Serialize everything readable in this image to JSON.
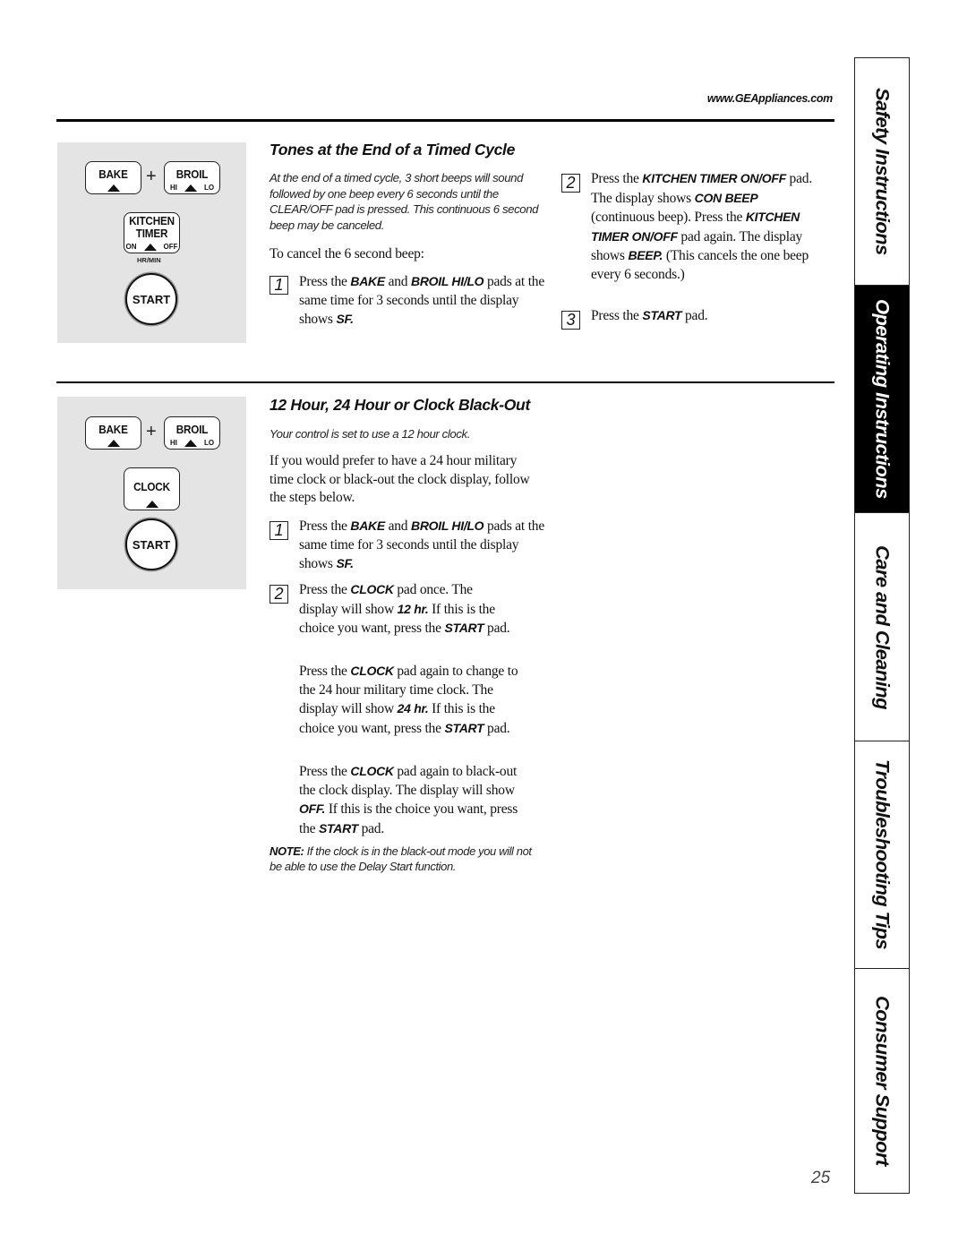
{
  "header": {
    "url": "www.GEAppliances.com"
  },
  "section1": {
    "title": "Tones at the End of a Timed Cycle",
    "intro": "At the end of a timed cycle, 3 short beeps will sound followed by one beep every 6 seconds until the CLEAR/OFF pad is pressed. This continuous 6 second beep may be canceled.",
    "lead": "To cancel the 6 second beep:",
    "steps": [
      {
        "num": "1",
        "parts": [
          "Press the ",
          "BAKE",
          " and ",
          "BROIL HI/LO",
          " pads at the same time for 3 seconds until the display shows ",
          "SF."
        ]
      },
      {
        "num": "2",
        "parts": [
          "Press the ",
          "KITCHEN TIMER ON/OFF",
          " pad. The display shows ",
          "CON BEEP",
          " (continuous beep). Press the ",
          "KITCHEN TIMER ON/OFF",
          " pad again. The display shows ",
          "BEEP.",
          " (This cancels the one beep every 6 seconds.)"
        ]
      },
      {
        "num": "3",
        "parts": [
          "Press the ",
          "START",
          " pad."
        ]
      }
    ],
    "keypad": {
      "bake": "BAKE",
      "plus": "+",
      "broil": "BROIL",
      "broil_hi": "HI",
      "broil_lo": "LO",
      "timer_line1": "KITCHEN",
      "timer_line2": "TIMER",
      "timer_on": "ON",
      "timer_off": "OFF",
      "hrmin": "HR/MIN",
      "start": "START"
    }
  },
  "section2": {
    "title": "12 Hour, 24 Hour or Clock Black-Out",
    "intro": "Your control is set to use a 12 hour clock.",
    "lead": "If you would prefer to have a 24 hour military time clock or black-out the clock display, follow the steps below.",
    "steps": [
      {
        "num": "1",
        "parts": [
          "Press the ",
          "BAKE",
          " and ",
          "BROIL HI/LO",
          " pads at the same time for 3 seconds until the display shows ",
          "SF."
        ]
      },
      {
        "num": "2",
        "parts": [
          "Press the ",
          "CLOCK",
          " pad once. The display will show ",
          "12 hr.",
          " If this is the choice you want, press the ",
          "START",
          " pad."
        ]
      }
    ],
    "para2": [
      "Press the ",
      "CLOCK",
      " pad again to change to the 24 hour military time clock. The display will show ",
      "24 hr.",
      " If this is the choice you want, press the ",
      "START",
      " pad."
    ],
    "para3": [
      "Press the ",
      "CLOCK",
      " pad again to black-out the clock display. The display will show ",
      "OFF.",
      " If this is the choice you want, press the ",
      "START",
      " pad."
    ],
    "note_label": "NOTE:",
    "note_text": " If the clock is in the black-out mode you will not be able to use the Delay Start function.",
    "keypad": {
      "bake": "BAKE",
      "plus": "+",
      "broil": "BROIL",
      "broil_hi": "HI",
      "broil_lo": "LO",
      "clock": "CLOCK",
      "start": "START"
    }
  },
  "tabs": [
    {
      "label": "Safety Instructions",
      "active": false
    },
    {
      "label": "Operating Instructions",
      "active": true
    },
    {
      "label": "Care and Cleaning",
      "active": false
    },
    {
      "label": "Troubleshooting Tips",
      "active": false
    },
    {
      "label": "Consumer Support",
      "active": false
    }
  ],
  "page_number": "25"
}
